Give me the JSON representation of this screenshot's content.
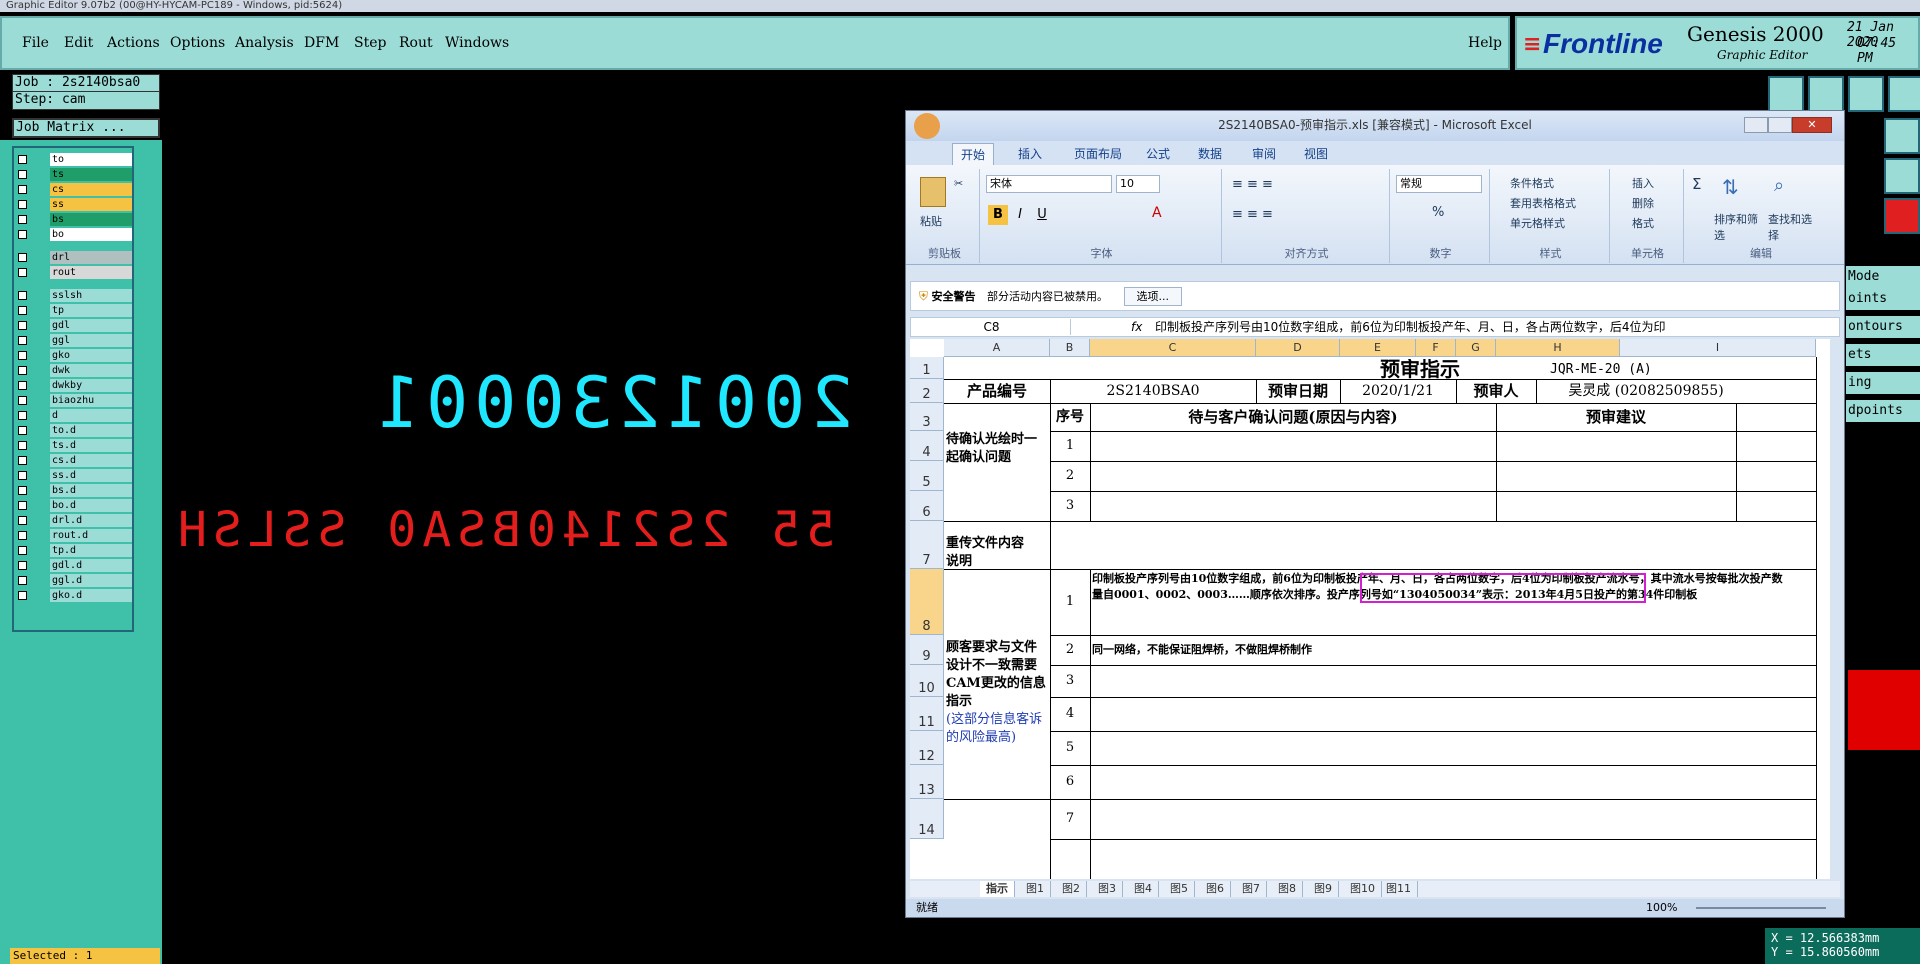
{
  "titlebar": {
    "title": "Graphic Editor 9.07b2 (00@HY-HYCAM-PC189 - Windows, pid:5624)"
  },
  "menu": {
    "file": "File",
    "edit": "Edit",
    "actions": "Actions",
    "options": "Options",
    "analysis": "Analysis",
    "dfm": "DFM",
    "step": "Step",
    "rout": "Rout",
    "windows": "Windows",
    "help": "Help"
  },
  "logo": {
    "brand": "Frontline",
    "product": "Genesis 2000",
    "subtitle": "Graphic Editor",
    "date": "21 Jan 2020",
    "time": "07:45 PM"
  },
  "job": {
    "job_label": "Job : 2s2140bsa0",
    "step_label": "Step: cam",
    "matrix_button": "Job Matrix ..."
  },
  "layers": [
    {
      "name": "to",
      "color": "#ffffff"
    },
    {
      "name": "ts",
      "color": "#1f9e6a"
    },
    {
      "name": "cs",
      "color": "#f5c242"
    },
    {
      "name": "ss",
      "color": "#f5c242"
    },
    {
      "name": "bs",
      "color": "#1f9e6a"
    },
    {
      "name": "bo",
      "color": "#ffffff"
    },
    {
      "name": "drl",
      "color": "#b0c0c0"
    },
    {
      "name": "rout",
      "color": "#d8d8d8"
    },
    {
      "name": "sslsh",
      "color": "#9bdcd7"
    },
    {
      "name": "tp",
      "color": "#9bdcd7"
    },
    {
      "name": "gdl",
      "color": "#9bdcd7"
    },
    {
      "name": "ggl",
      "color": "#9bdcd7"
    },
    {
      "name": "gko",
      "color": "#9bdcd7"
    },
    {
      "name": "dwk",
      "color": "#9bdcd7"
    },
    {
      "name": "dwkby",
      "color": "#9bdcd7"
    },
    {
      "name": "biaozhu",
      "color": "#9bdcd7"
    },
    {
      "name": "d",
      "color": "#9bdcd7"
    },
    {
      "name": "to.d",
      "color": "#9bdcd7"
    },
    {
      "name": "ts.d",
      "color": "#9bdcd7"
    },
    {
      "name": "cs.d",
      "color": "#9bdcd7"
    },
    {
      "name": "ss.d",
      "color": "#9bdcd7"
    },
    {
      "name": "bs.d",
      "color": "#9bdcd7"
    },
    {
      "name": "bo.d",
      "color": "#9bdcd7"
    },
    {
      "name": "drl.d",
      "color": "#9bdcd7"
    },
    {
      "name": "rout.d",
      "color": "#9bdcd7"
    },
    {
      "name": "tp.d",
      "color": "#9bdcd7"
    },
    {
      "name": "gdl.d",
      "color": "#9bdcd7"
    },
    {
      "name": "ggl.d",
      "color": "#9bdcd7"
    },
    {
      "name": "gko.d",
      "color": "#9bdcd7"
    }
  ],
  "canvas": {
    "text_cyan": "2001230001",
    "text_red": "55 2S2140BSA0 SSLSH"
  },
  "status": {
    "selected": "Selected : 1",
    "x": "X = 12.566383mm",
    "y": "Y = 15.860560mm"
  },
  "right_list": [
    "Mode",
    "oints",
    "ontours",
    "ets",
    "ing",
    "dpoints"
  ],
  "excel": {
    "title": "2S2140BSA0-预审指示.xls [兼容模式] - Microsoft Excel",
    "tabs": [
      "开始",
      "插入",
      "页面布局",
      "公式",
      "数据",
      "审阅",
      "视图"
    ],
    "ribbon": {
      "paste": "粘贴",
      "clipboard": "剪贴板",
      "font_name": "宋体",
      "font_size": "10",
      "font": "字体",
      "alignment": "对齐方式",
      "number_format": "常规",
      "number": "数字",
      "cond_format": "条件格式",
      "table_format": "套用表格格式",
      "cell_style": "单元格样式",
      "styles": "样式",
      "insert": "插入",
      "delete": "删除",
      "format": "格式",
      "cells": "单元格",
      "sort": "排序和筛选",
      "find": "查找和选择",
      "editing": "编辑"
    },
    "security": {
      "label": "安全警告",
      "message": "部分活动内容已被禁用。",
      "button": "选项..."
    },
    "namebox": "C8",
    "formula": "印制板投产序列号由10位数字组成，前6位为印制板投产年、月、日，各占两位数字，后4位为印",
    "columns": [
      "A",
      "B",
      "C",
      "D",
      "E",
      "F",
      "G",
      "H",
      "I"
    ],
    "rows": [
      "1",
      "2",
      "3",
      "4",
      "5",
      "6",
      "7",
      "8",
      "9",
      "10",
      "11",
      "12",
      "13",
      "14"
    ],
    "cells": {
      "title": "预审指示",
      "doc_no": "JQR-ME-20 (A)",
      "product_no_label": "产品编号",
      "product_no": "2S2140BSA0",
      "review_date_label": "预审日期",
      "review_date": "2020/1/21",
      "reviewer_label": "预审人",
      "reviewer": "吴灵成 (02082509855)",
      "seq_label": "序号",
      "issue_label": "待与客户确认问题(原因与内容)",
      "suggest_label": "预审建议",
      "confirm_label": "待确认光绘时一起确认问题",
      "reupload_label": "重传文件内容说明",
      "mismatch_label": "顾客要求与文件设计不一致需要CAM更改的信息指示",
      "mismatch_note": "(这部分信息客诉的风险最高)",
      "n1": "1",
      "n2": "2",
      "n3": "3",
      "n4": "4",
      "n5": "5",
      "n6": "6",
      "n7": "7",
      "row8_text": "印制板投产序列号由10位数字组成，前6位为印制板投产年、月、日，各占两位数字，后4位为印制板投产流水号，其中流水号按每批次投产数量自0001、0002、0003……顺序依次排序。投产序列号如“1304050034”表示：2013年4月5日投产的第34件印制板",
      "row9_text": "同一网络，不能保证阻焊桥，不做阻焊桥制作"
    },
    "sheet_tabs": [
      "指示",
      "图1",
      "图2",
      "图3",
      "图4",
      "图5",
      "图6",
      "图7",
      "图8",
      "图9",
      "图10",
      "图11"
    ],
    "statusbar": {
      "ready": "就绪",
      "zoom": "100%"
    }
  }
}
